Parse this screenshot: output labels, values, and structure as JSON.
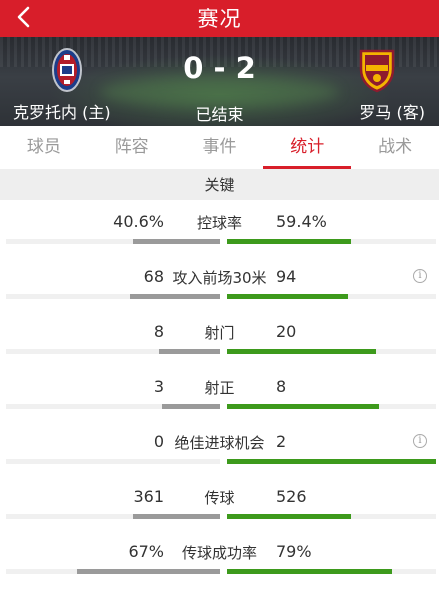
{
  "header": {
    "title": "赛况",
    "back_icon": "chevron-left-icon"
  },
  "match": {
    "home_team": "克罗托内 (主)",
    "away_team": "罗马 (客)",
    "score": "0 - 2",
    "status": "已结束",
    "home_crest_icon": "crotone-crest-icon",
    "away_crest_icon": "roma-crest-icon"
  },
  "tabs": [
    {
      "label": "球员"
    },
    {
      "label": "阵容"
    },
    {
      "label": "事件"
    },
    {
      "label": "统计",
      "active": true
    },
    {
      "label": "战术"
    }
  ],
  "section": {
    "title": "关键"
  },
  "stats": [
    {
      "label": "控球率",
      "home": "40.6%",
      "away": "59.4%",
      "home_share": 0.406,
      "away_share": 0.594,
      "info": false
    },
    {
      "label": "攻入前场30米",
      "home": "68",
      "away": "94",
      "home_share": 0.42,
      "away_share": 0.58,
      "info": true
    },
    {
      "label": "射门",
      "home": "8",
      "away": "20",
      "home_share": 0.286,
      "away_share": 0.714,
      "info": false
    },
    {
      "label": "射正",
      "home": "3",
      "away": "8",
      "home_share": 0.273,
      "away_share": 0.727,
      "info": false
    },
    {
      "label": "绝佳进球机会",
      "home": "0",
      "away": "2",
      "home_share": 0.0,
      "away_share": 1.0,
      "info": true
    },
    {
      "label": "传球",
      "home": "361",
      "away": "526",
      "home_share": 0.407,
      "away_share": 0.593,
      "info": false
    },
    {
      "label": "传球成功率",
      "home": "67%",
      "away": "79%",
      "home_share": 0.67,
      "away_share": 0.79,
      "info": false
    }
  ],
  "colors": {
    "brand": "#d81e2a",
    "home_bar": "#9a9a9a",
    "away_bar": "#3d9a1c"
  }
}
